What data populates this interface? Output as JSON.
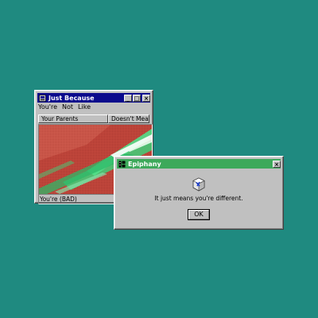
{
  "window_main": {
    "title": "Just Because",
    "menu": [
      "You're",
      "Not",
      "Like"
    ],
    "columns": [
      "Your Parents",
      "Doesn't Mean"
    ],
    "status": "You're (BAD)"
  },
  "window_dialog": {
    "title": "Epiphany",
    "message": "It just means you're different.",
    "ok_label": "OK"
  },
  "colors": {
    "desktop": "#1f8a80",
    "title_main": "#0a0a8c",
    "title_dialog": "#3da95a",
    "face": "#c0c0c0"
  },
  "icons": [
    "app-icon",
    "minimize-icon",
    "maximize-icon",
    "close-icon",
    "dialog-app-icon",
    "close-icon",
    "cube-info-icon"
  ]
}
